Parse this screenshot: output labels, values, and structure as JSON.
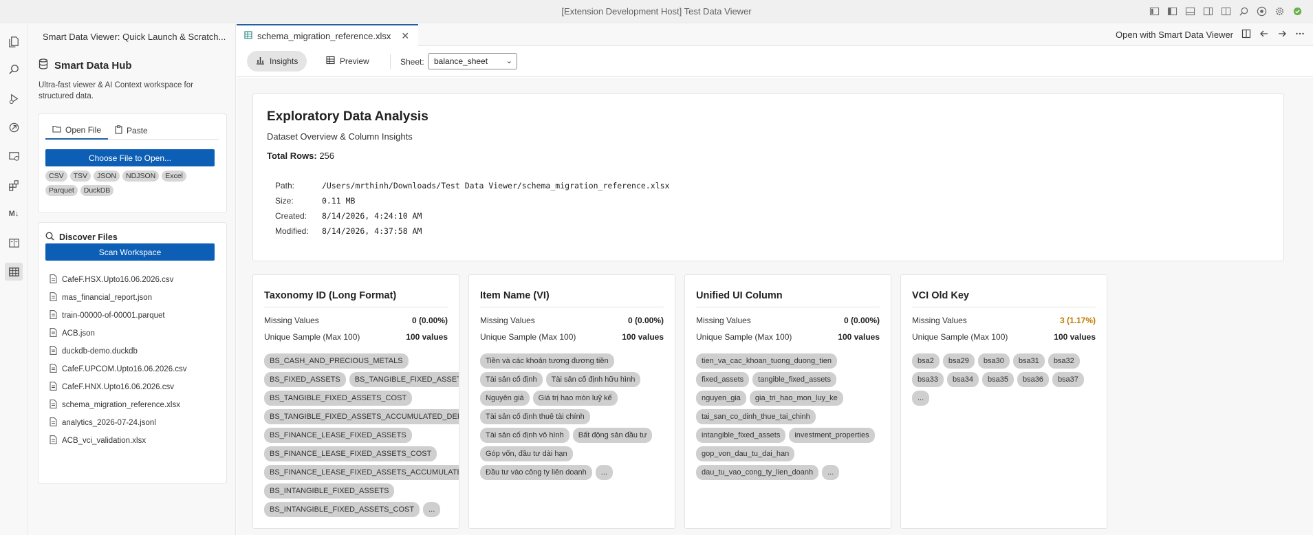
{
  "window": {
    "title": "[Extension Development Host] Test Data Viewer"
  },
  "sidebar": {
    "header": "Smart Data Viewer: Quick Launch & Scratch...",
    "hub_title": "Smart Data Hub",
    "hub_desc": "Ultra-fast viewer & AI Context workspace for structured data.",
    "tabs": [
      {
        "label": "Open File"
      },
      {
        "label": "Paste"
      }
    ],
    "choose_button": "Choose File to Open...",
    "formats": [
      "CSV",
      "TSV",
      "JSON",
      "NDJSON",
      "Excel",
      "Parquet",
      "DuckDB"
    ],
    "discover_title": "Discover Files",
    "scan_button": "Scan Workspace",
    "files": [
      "CafeF.HSX.Upto16.06.2026.csv",
      "mas_financial_report.json",
      "train-00000-of-00001.parquet",
      "ACB.json",
      "duckdb-demo.duckdb",
      "CafeF.UPCOM.Upto16.06.2026.csv",
      "CafeF.HNX.Upto16.06.2026.csv",
      "schema_migration_reference.xlsx",
      "analytics_2026-07-24.jsonl",
      "ACB_vci_validation.xlsx"
    ]
  },
  "editor": {
    "tab_name": "schema_migration_reference.xlsx",
    "open_with": "Open with Smart Data Viewer"
  },
  "toolbar": {
    "insights": "Insights",
    "preview": "Preview",
    "sheet_label": "Sheet:",
    "sheet_value": "balance_sheet"
  },
  "overview": {
    "title": "Exploratory Data Analysis",
    "subtitle": "Dataset Overview & Column Insights",
    "total_rows_label": "Total Rows:",
    "total_rows_value": "256",
    "meta": [
      {
        "k": "Path:",
        "v": "/Users/mrthinh/Downloads/Test Data Viewer/schema_migration_reference.xlsx"
      },
      {
        "k": "Size:",
        "v": "0.11 MB"
      },
      {
        "k": "Created:",
        "v": "8/14/2026, 4:24:10 AM"
      },
      {
        "k": "Modified:",
        "v": "8/14/2026, 4:37:58 AM"
      }
    ]
  },
  "columns": [
    {
      "title": "Taxonomy ID (Long Format)",
      "missing_label": "Missing Values",
      "missing_value": "0 (0.00%)",
      "unique_label": "Unique Sample (Max 100)",
      "unique_value": "100 values",
      "samples": [
        "BS_CASH_AND_PRECIOUS_METALS",
        "BS_FIXED_ASSETS",
        "BS_TANGIBLE_FIXED_ASSETS",
        "BS_TANGIBLE_FIXED_ASSETS_COST",
        "BS_TANGIBLE_FIXED_ASSETS_ACCUMULATED_DEPRECIATION",
        "BS_FINANCE_LEASE_FIXED_ASSETS",
        "BS_FINANCE_LEASE_FIXED_ASSETS_COST",
        "BS_FINANCE_LEASE_FIXED_ASSETS_ACCUMULATED_DEPRECIATION",
        "BS_INTANGIBLE_FIXED_ASSETS",
        "BS_INTANGIBLE_FIXED_ASSETS_COST",
        "..."
      ]
    },
    {
      "title": "Item Name (VI)",
      "missing_label": "Missing Values",
      "missing_value": "0 (0.00%)",
      "unique_label": "Unique Sample (Max 100)",
      "unique_value": "100 values",
      "samples": [
        "Tiền và các khoản tương đương tiền",
        "Tài sản cố định",
        "Tài sản cố định hữu hình",
        "Nguyên giá",
        "Giá trị hao mòn luỹ kế",
        "Tài sản cố định thuê tài chính",
        "Tài sản cố định vô hình",
        "Bất động sản đầu tư",
        "Góp vốn, đầu tư dài hạn",
        "Đầu tư vào công ty liên doanh",
        "..."
      ]
    },
    {
      "title": "Unified UI Column",
      "missing_label": "Missing Values",
      "missing_value": "0 (0.00%)",
      "unique_label": "Unique Sample (Max 100)",
      "unique_value": "100 values",
      "samples": [
        "tien_va_cac_khoan_tuong_duong_tien",
        "fixed_assets",
        "tangible_fixed_assets",
        "nguyen_gia",
        "gia_tri_hao_mon_luy_ke",
        "tai_san_co_dinh_thue_tai_chinh",
        "intangible_fixed_assets",
        "investment_properties",
        "gop_von_dau_tu_dai_han",
        "dau_tu_vao_cong_ty_lien_doanh",
        "..."
      ]
    },
    {
      "title": "VCI Old Key",
      "missing_label": "Missing Values",
      "missing_value": "3 (1.17%)",
      "missing_color": "#c07a00",
      "unique_label": "Unique Sample (Max 100)",
      "unique_value": "100 values",
      "samples": [
        "bsa2",
        "bsa29",
        "bsa30",
        "bsa31",
        "bsa32",
        "bsa33",
        "bsa34",
        "bsa35",
        "bsa36",
        "bsa37",
        "..."
      ]
    }
  ],
  "colors": {
    "accent": "#0d5fb5",
    "warn": "#c07a00"
  }
}
